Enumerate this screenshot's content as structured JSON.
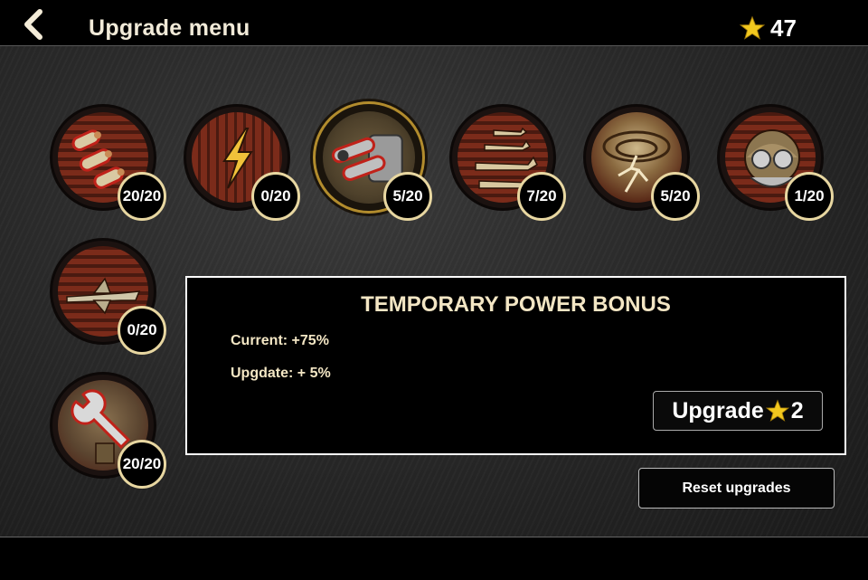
{
  "header": {
    "back_icon": "chevron-left-icon",
    "title": "Upgrade menu",
    "star_icon": "star-icon",
    "stars": "47"
  },
  "upgrades": [
    {
      "name": "ammo",
      "icon": "bullets-icon",
      "progress": "20/20"
    },
    {
      "name": "lightning",
      "icon": "lightning-icon",
      "progress": "0/20"
    },
    {
      "name": "temporary-power",
      "icon": "cannons-icon",
      "progress": "5/20",
      "selected": true
    },
    {
      "name": "squadron",
      "icon": "planes-icon",
      "progress": "7/20"
    },
    {
      "name": "storm",
      "icon": "tornado-icon",
      "progress": "5/20"
    },
    {
      "name": "pilot",
      "icon": "helmet-icon",
      "progress": "1/20"
    },
    {
      "name": "wingman",
      "icon": "plane-icon",
      "progress": "0/20"
    },
    {
      "name": "repair",
      "icon": "wrench-icon",
      "progress": "20/20"
    }
  ],
  "info": {
    "title": "TEMPORARY POWER BONUS",
    "current": "Current: +75%",
    "upgrade_line": "Upgdate: + 5%",
    "button_label": "Upgrade",
    "button_cost": "2"
  },
  "reset_label": "Reset upgrades",
  "colors": {
    "star": "#f2c81e",
    "badge_border": "#e8d7a1",
    "disc_red": "#7b2b1a",
    "selected_ring": "#b28c2d"
  }
}
